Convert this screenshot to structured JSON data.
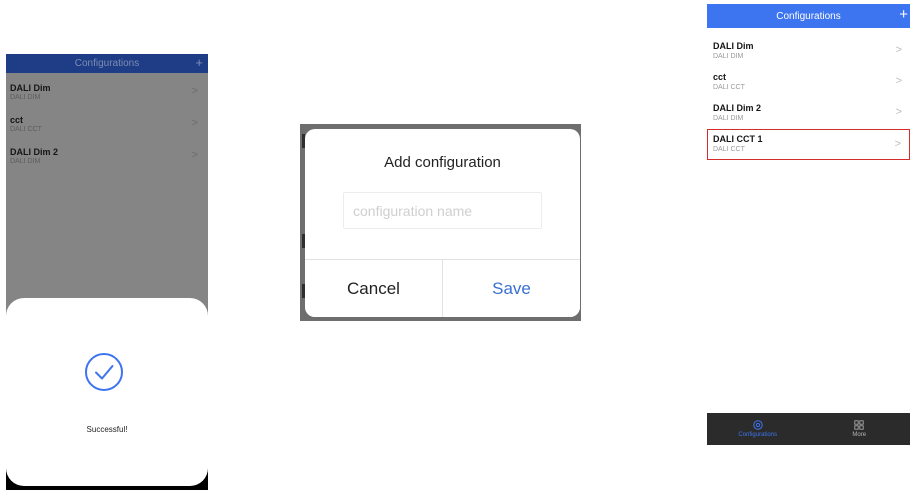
{
  "panel_success": {
    "header_title": "Configurations",
    "plus_glyph": "+",
    "chevron_glyph": ">",
    "items": [
      {
        "name": "DALI Dim",
        "type": "DALI DIM"
      },
      {
        "name": "cct",
        "type": "DALI CCT"
      },
      {
        "name": "DALI Dim 2",
        "type": "DALI DIM"
      }
    ],
    "success_icon": "check-circle-icon",
    "success_message": "Successful!"
  },
  "panel_dialog": {
    "title": "Add configuration",
    "name_placeholder": "configuration name",
    "name_value": "",
    "cancel_label": "Cancel",
    "save_label": "Save",
    "save_color": "#3a6fd6"
  },
  "panel_list": {
    "header_title": "Configurations",
    "plus_glyph": "+",
    "chevron_glyph": ">",
    "header_color": "#3d74f0",
    "highlight_color": "#d62c2c",
    "items": [
      {
        "name": "DALI Dim",
        "type": "DALI DIM"
      },
      {
        "name": "cct",
        "type": "DALI CCT"
      },
      {
        "name": "DALI Dim 2",
        "type": "DALI DIM"
      },
      {
        "name": "DALI CCT 1",
        "type": "DALI CCT"
      }
    ],
    "tabs": [
      {
        "label": "Configurations",
        "icon": "configurations-icon",
        "active": true
      },
      {
        "label": "More",
        "icon": "grid-icon",
        "active": false
      }
    ]
  }
}
